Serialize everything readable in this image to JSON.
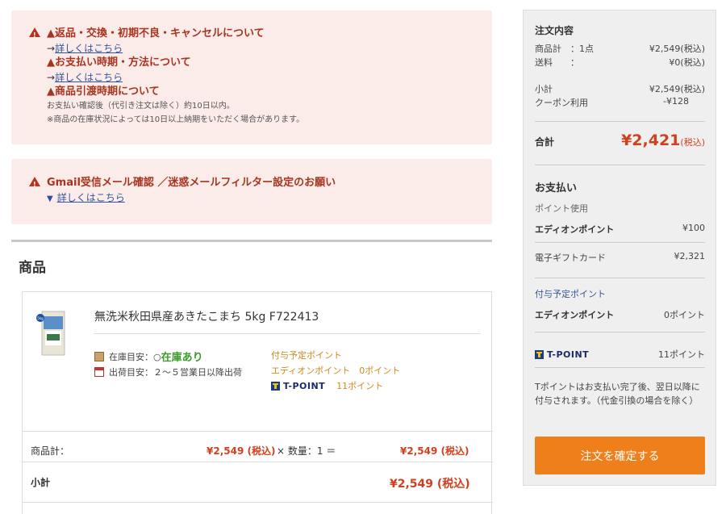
{
  "notices": {
    "n1_title": "▲返品・交換・初期不良・キャンセルについて",
    "n1_arrow": "→",
    "n1_link": "詳しくはこちら",
    "n2_title": "▲お支払い時期・方法について",
    "n2_arrow": "→",
    "n2_link": "詳しくはこちら",
    "n3_title": "▲商品引渡時期について",
    "n3_text1": "お支払い確認後（代引き注文は除く）約10日以内。",
    "n3_text2": "※商品の在庫状況によっては10日以上納期をいただく場合があります。",
    "gmail_title": "Gmail受信メール確認 ／迷惑メールフィルター設定のお願い",
    "gmail_link": "詳しくはこちら"
  },
  "section_title": "商品",
  "item": {
    "name": "無洗米秋田県産あきたこまち 5kg F722413",
    "stock_label": "在庫目安：○",
    "stock_value": "在庫あり",
    "ship_label": "出荷目安：２～５営業日以降出荷",
    "points_heading": "付与予定ポイント",
    "edion_points": "エディオンポイント　0ポイント",
    "tpoint_logo": "T-POINT",
    "tpoint_value": "11ポイント",
    "img_badge": "5kg"
  },
  "price": {
    "subtotal_label": "商品計：",
    "unit_price": "¥2,549 (税込)",
    "qty_text": "× 数量：1 ＝",
    "line_total": "¥2,549 (税込)",
    "shoukei_label": "小計",
    "shoukei_value": "¥2,549 (税込)"
  },
  "summary": {
    "title": "注文内容",
    "goods_label": "商品計　：1点",
    "goods_value": "¥2,549(税込)",
    "ship_label": "送料　　：",
    "ship_value": "¥0(税込)",
    "sub_label": "小計",
    "sub_value": "¥2,549(税込)",
    "coupon_label": "クーポン利用",
    "coupon_value": "-¥128",
    "total_label": "合計",
    "total_value": "¥2,421",
    "total_tax": "(税込)",
    "pay_title": "お支払い",
    "point_use": "ポイント使用",
    "edion_label": "エディオンポイント",
    "edion_value": "¥100",
    "gift_label": "電子ギフトカード",
    "gift_value": "¥2,321",
    "grant_title": "付与予定ポイント",
    "grant_edion_label": "エディオンポイント",
    "grant_edion_value": "0ポイント",
    "tpoint_logo": "T-POINT",
    "tpoint_value": "11ポイント",
    "note1": "Tポイントはお支払い完了後、翌日以降に",
    "note2": "付与されます。（代金引換の場合を除く）",
    "confirm": "注文を確定する"
  }
}
